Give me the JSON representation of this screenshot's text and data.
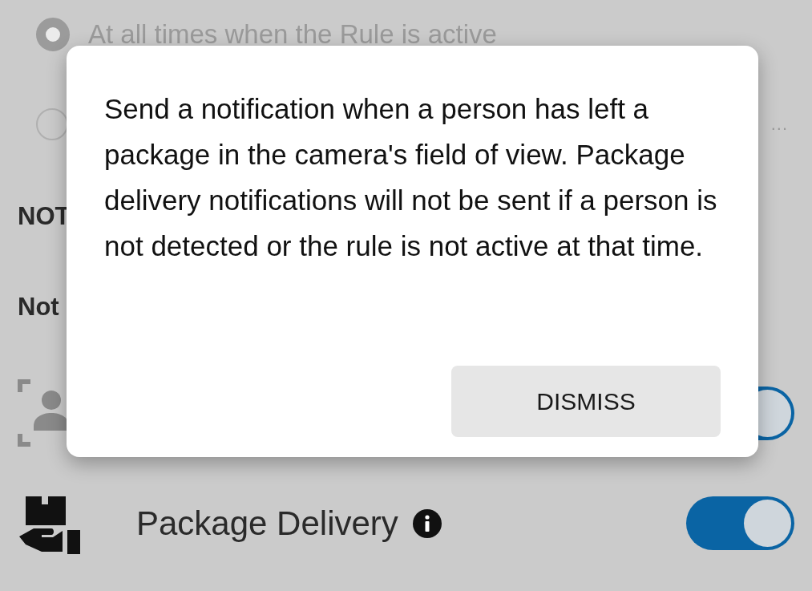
{
  "schedule_options": [
    {
      "label": "At all times when the Rule is active",
      "selected": true
    },
    {
      "overflow_mark": "...",
      "selected": false
    }
  ],
  "section_heading": "NOT",
  "subheading": "Not",
  "detections": [
    {
      "kind": "person",
      "on": true
    },
    {
      "kind": "package",
      "label": "Package Delivery",
      "on": true
    }
  ],
  "dialog": {
    "message": "Send a notification when a person has left a package in the camera's field of view. Package delivery notifications will not be sent if a person is not detected or the rule is not active at that time.",
    "button": "DISMISS"
  }
}
